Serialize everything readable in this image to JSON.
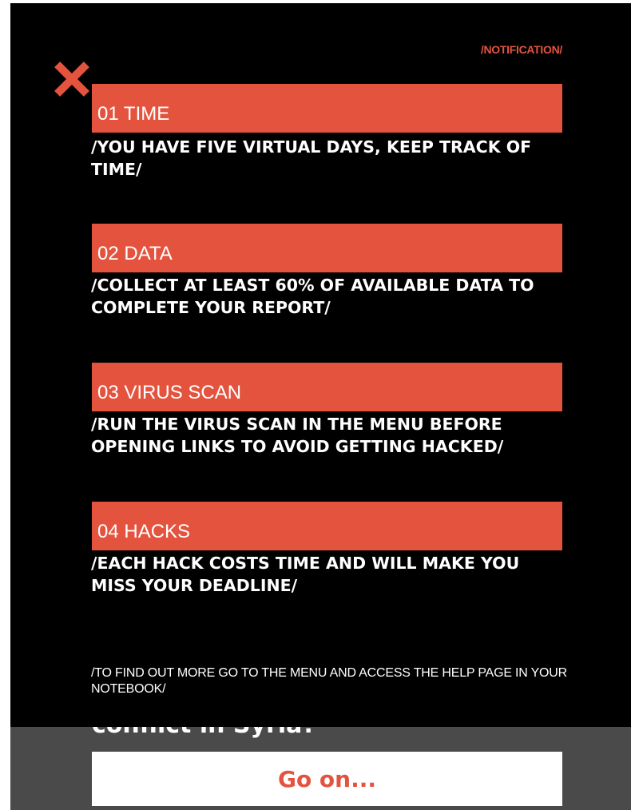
{
  "background_screen": {
    "partial_heading": "conflict in Syria?",
    "go_on_label": "Go on..."
  },
  "notification": {
    "label": "/NOTIFICATION/",
    "close_icon": "close-x-icon",
    "items": [
      {
        "title": "01 TIME",
        "description": "/YOU HAVE FIVE VIRTUAL DAYS, KEEP TRACK OF TIME/"
      },
      {
        "title": "02 DATA",
        "description": "/COLLECT AT LEAST 60% OF AVAILABLE DATA TO COMPLETE YOUR REPORT/"
      },
      {
        "title": "03 VIRUS SCAN",
        "description": "/RUN THE VIRUS SCAN IN THE MENU BEFORE OPENING LINKS TO AVOID GETTING HACKED/"
      },
      {
        "title": "04 HACKS",
        "description": "/EACH HACK COSTS TIME AND WILL MAKE YOU MISS YOUR DEADLINE/"
      }
    ],
    "footer": "/TO FIND OUT MORE GO TO THE MENU AND ACCESS THE HELP PAGE IN YOUR NOTEBOOK/"
  },
  "colors": {
    "accent": "#e4533e",
    "overlay": "#000000",
    "underlay": "#4a4a4a"
  }
}
